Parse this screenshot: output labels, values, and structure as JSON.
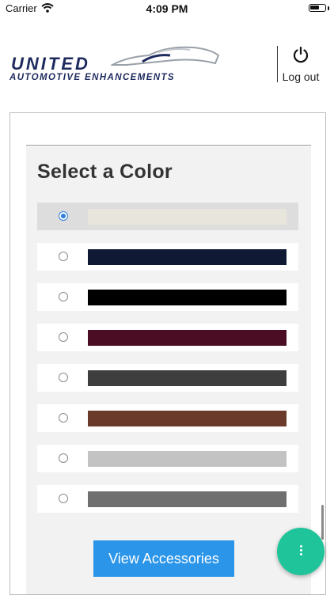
{
  "status_bar": {
    "carrier": "Carrier",
    "time": "4:09 PM",
    "battery_level": 0.65
  },
  "header": {
    "logo_line1": "UNITED",
    "logo_line2": "AUTOMOTIVE ENHANCEMENTS",
    "logout_label": "Log out"
  },
  "color_picker": {
    "title": "Select a Color",
    "options": [
      {
        "color": "#e8e6dc",
        "selected": true
      },
      {
        "color": "#101934",
        "selected": false
      },
      {
        "color": "#000000",
        "selected": false
      },
      {
        "color": "#4b0d24",
        "selected": false
      },
      {
        "color": "#3e3e3e",
        "selected": false
      },
      {
        "color": "#6b3a2a",
        "selected": false
      },
      {
        "color": "#c3c3c3",
        "selected": false
      },
      {
        "color": "#6f6f6f",
        "selected": false
      }
    ]
  },
  "actions": {
    "view_accessories_label": "View Accessories"
  },
  "colors": {
    "brand_navy": "#1d2a5e",
    "button_blue": "#2b95e9",
    "fab_green": "#1fc49a",
    "radio_blue": "#2e7de1"
  }
}
